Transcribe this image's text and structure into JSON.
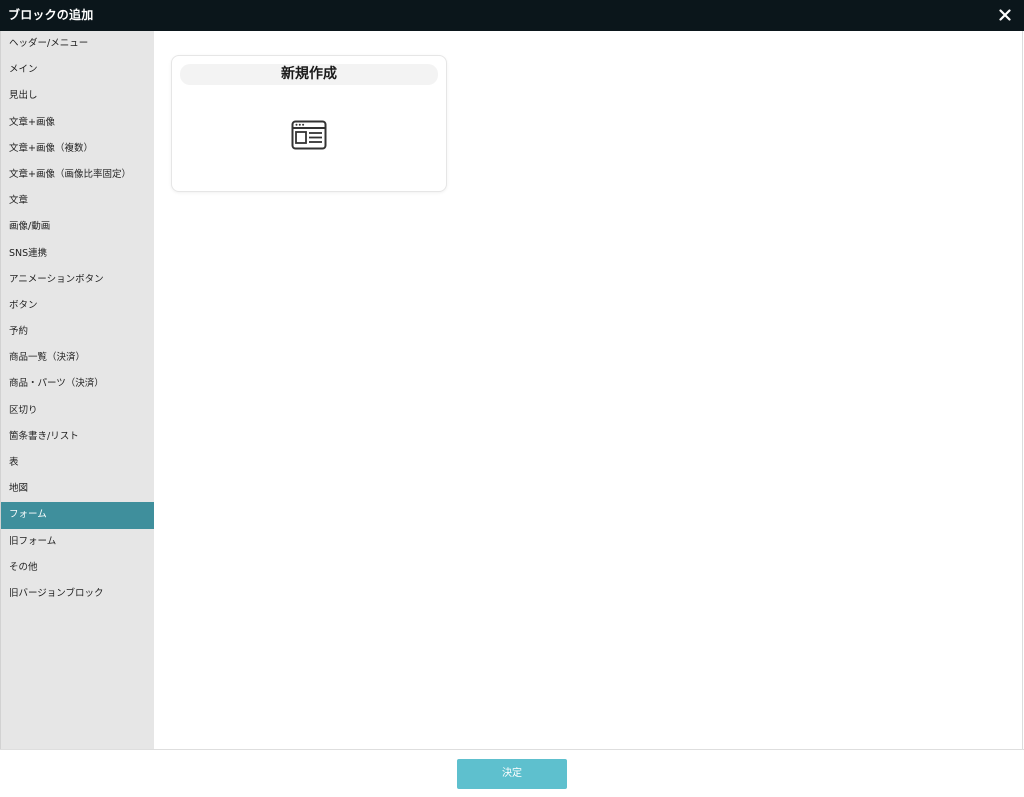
{
  "window": {
    "title": "ブロックの追加",
    "close_icon": "close-icon"
  },
  "sidebar": {
    "items": [
      {
        "label": "ヘッダー/メニュー"
      },
      {
        "label": "メイン"
      },
      {
        "label": "見出し"
      },
      {
        "label": "文章+画像"
      },
      {
        "label": "文章+画像（複数）"
      },
      {
        "label": "文章+画像（画像比率固定）"
      },
      {
        "label": "文章"
      },
      {
        "label": "画像/動画"
      },
      {
        "label": "SNS連携"
      },
      {
        "label": "アニメーションボタン"
      },
      {
        "label": "ボタン"
      },
      {
        "label": "予約"
      },
      {
        "label": "商品一覧（決済）"
      },
      {
        "label": "商品・パーツ（決済）"
      },
      {
        "label": "区切り"
      },
      {
        "label": "箇条書き/リスト"
      },
      {
        "label": "表"
      },
      {
        "label": "地図"
      },
      {
        "label": "フォーム"
      },
      {
        "label": "旧フォーム"
      },
      {
        "label": "その他"
      },
      {
        "label": "旧バージョンブロック"
      }
    ],
    "active_index": 18
  },
  "main": {
    "cards": [
      {
        "title": "新規作成",
        "icon": "browser-window-icon"
      }
    ]
  },
  "footer": {
    "confirm_label": "決定"
  },
  "colors": {
    "titlebar_bg": "#0b161b",
    "sidebar_bg": "#e6e6e6",
    "sidebar_active_bg": "#3f8f9c",
    "confirm_button_bg": "#5ec0ce"
  }
}
